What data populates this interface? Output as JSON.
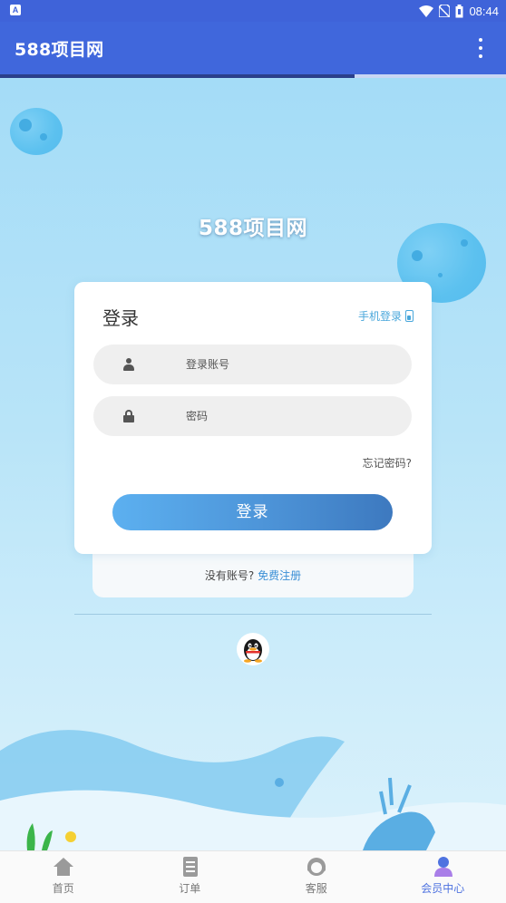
{
  "status_bar": {
    "time": "08:44"
  },
  "app_bar": {
    "title": "588项目网"
  },
  "page": {
    "brand": "588项目网",
    "login_card": {
      "title": "登录",
      "phone_login": "手机登录",
      "account_placeholder": "登录账号",
      "password_placeholder": "密码",
      "forgot_password": "忘记密码?",
      "login_button": "登录"
    },
    "register": {
      "prompt": "没有账号?",
      "link": "免费注册"
    }
  },
  "bottom_nav": {
    "items": [
      {
        "label": "首页",
        "icon": "home-icon"
      },
      {
        "label": "订单",
        "icon": "order-icon"
      },
      {
        "label": "客服",
        "icon": "customer-service-icon"
      },
      {
        "label": "会员中心",
        "icon": "member-icon",
        "active": true
      }
    ]
  },
  "colors": {
    "primary": "#4067dc",
    "accent_link": "#49a7db",
    "active_nav": "#4f73e0"
  }
}
